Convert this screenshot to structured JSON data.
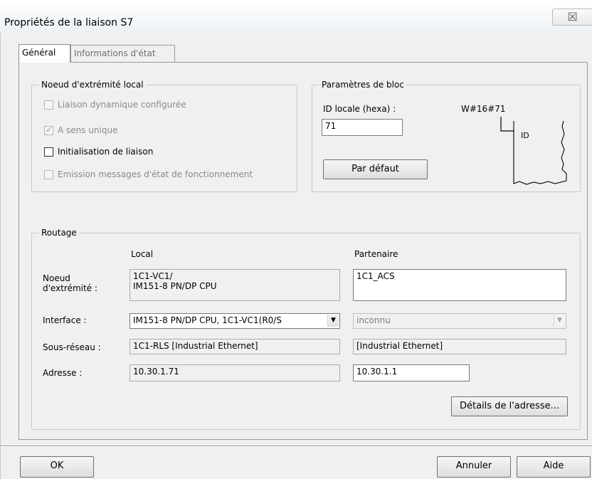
{
  "window": {
    "title": "Propriétés de la liaison S7",
    "close_glyph": "☒"
  },
  "tabs": [
    {
      "label": "Général",
      "active": true
    },
    {
      "label": "Informations d'état",
      "active": false
    }
  ],
  "local_endpoint": {
    "legend": "Noeud d'extrémité local",
    "options": [
      {
        "label": "Liaison dynamique configurée",
        "checked": false,
        "enabled": false
      },
      {
        "label": "A sens unique",
        "checked": true,
        "enabled": false
      },
      {
        "label": "Initialisation de liaison",
        "checked": false,
        "enabled": true
      },
      {
        "label": "Emission messages d'état de fonctionnement",
        "checked": false,
        "enabled": false
      }
    ]
  },
  "block_params": {
    "legend": "Paramètres de bloc",
    "local_id_label": "ID locale (hexa) :",
    "local_id_value": "71",
    "wvalue": "W#16#71",
    "block_id_label": "ID",
    "default_button": "Par défaut"
  },
  "routing": {
    "legend": "Routage",
    "col_local": "Local",
    "col_partner": "Partenaire",
    "endpoint_label": "Noeud\nd'extrémité :",
    "endpoint_local": "1C1-VC1/\nIM151-8 PN/DP CPU",
    "endpoint_partner": "1C1_ACS",
    "interface_label": "Interface :",
    "interface_local": "IM151-8 PN/DP CPU, 1C1-VC1(R0/S",
    "interface_partner": "inconnu",
    "subnet_label": "Sous-réseau :",
    "subnet_local": "1C1-RLS [Industrial Ethernet]",
    "subnet_partner": "[Industrial Ethernet]",
    "address_label": "Adresse :",
    "address_local": "10.30.1.71",
    "address_partner": "10.30.1.1",
    "details_button": "Détails de l'adresse..."
  },
  "footer": {
    "ok": "OK",
    "cancel": "Annuler",
    "help": "Aide"
  }
}
